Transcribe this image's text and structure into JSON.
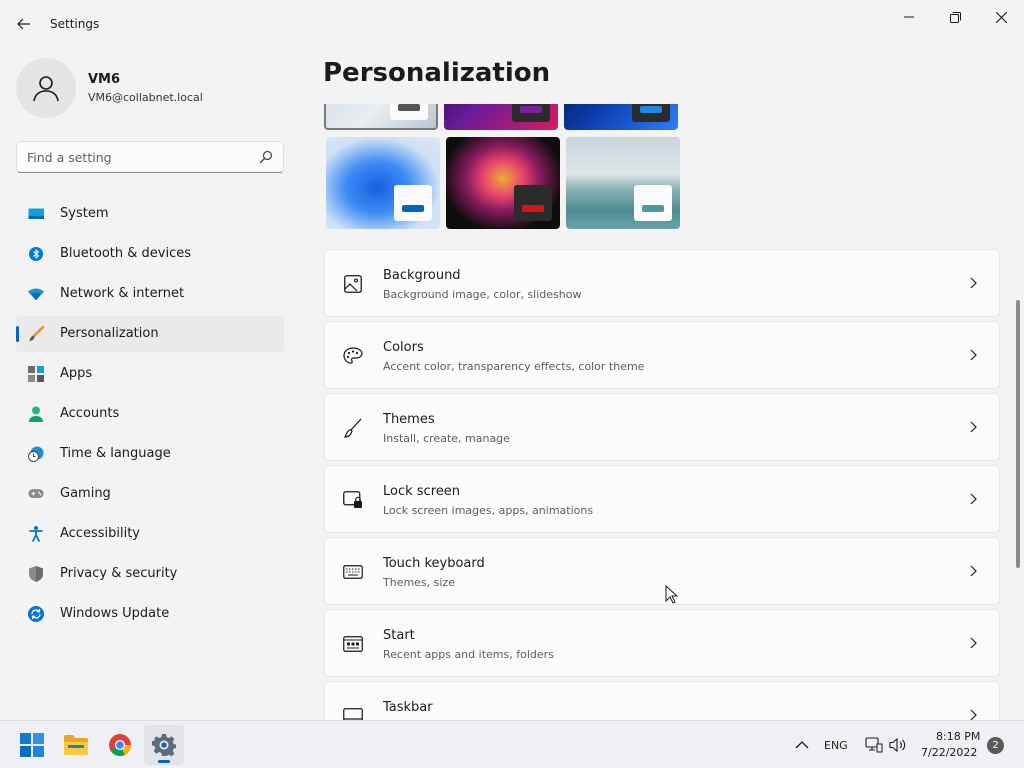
{
  "window": {
    "title": "Settings"
  },
  "user": {
    "name": "VM6",
    "email": "VM6@collabnet.local"
  },
  "search": {
    "placeholder": "Find a setting"
  },
  "sidebar": {
    "items": [
      {
        "label": "System",
        "icon": "system-icon"
      },
      {
        "label": "Bluetooth & devices",
        "icon": "bluetooth-icon"
      },
      {
        "label": "Network & internet",
        "icon": "wifi-icon"
      },
      {
        "label": "Personalization",
        "icon": "brush-icon",
        "active": true
      },
      {
        "label": "Apps",
        "icon": "apps-icon"
      },
      {
        "label": "Accounts",
        "icon": "person-icon"
      },
      {
        "label": "Time & language",
        "icon": "clock-globe-icon"
      },
      {
        "label": "Gaming",
        "icon": "gamepad-icon"
      },
      {
        "label": "Accessibility",
        "icon": "accessibility-icon"
      },
      {
        "label": "Privacy & security",
        "icon": "shield-icon"
      },
      {
        "label": "Windows Update",
        "icon": "update-icon"
      }
    ]
  },
  "main": {
    "title": "Personalization",
    "cards": [
      {
        "title": "Background",
        "subtitle": "Background image, color, slideshow",
        "icon": "image-icon"
      },
      {
        "title": "Colors",
        "subtitle": "Accent color, transparency effects, color theme",
        "icon": "palette-icon"
      },
      {
        "title": "Themes",
        "subtitle": "Install, create, manage",
        "icon": "brush-icon"
      },
      {
        "title": "Lock screen",
        "subtitle": "Lock screen images, apps, animations",
        "icon": "lock-screen-icon"
      },
      {
        "title": "Touch keyboard",
        "subtitle": "Themes, size",
        "icon": "keyboard-icon"
      },
      {
        "title": "Start",
        "subtitle": "Recent apps and items, folders",
        "icon": "start-icon"
      },
      {
        "title": "Taskbar",
        "subtitle": "",
        "icon": "taskbar-icon"
      }
    ]
  },
  "colors": {
    "accent": "#0067c0",
    "window_bg": "#f3f3f3",
    "card_bg": "#fbfbfb"
  },
  "taskbar": {
    "language": "ENG",
    "time": "8:18 PM",
    "date": "7/22/2022",
    "notifications": "2"
  }
}
